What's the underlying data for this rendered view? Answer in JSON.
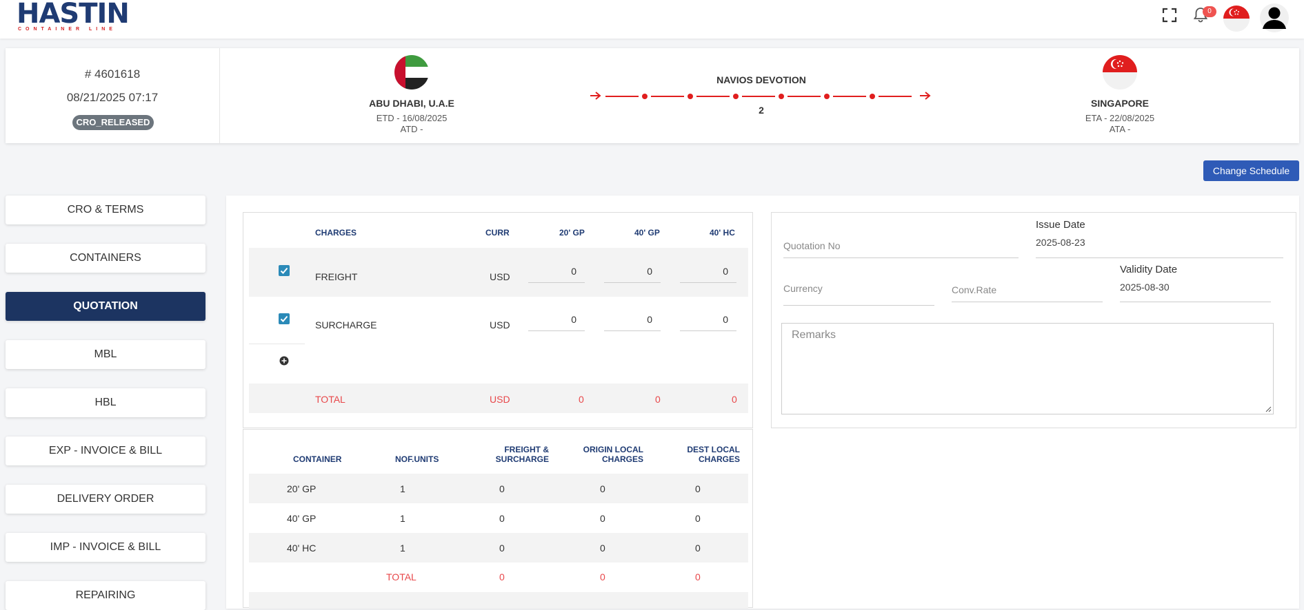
{
  "header": {
    "logo_main": "HASTIN",
    "logo_sub": "CONTAINER LINE",
    "notification_count": "0"
  },
  "voyage": {
    "booking_no": "# 4601618",
    "booking_datetime": "08/21/2025 07:17",
    "status": "CRO_RELEASED",
    "origin": {
      "name": "ABU DHABI, U.A.E",
      "etd": "ETD - 16/08/2025",
      "atd": "ATD -"
    },
    "vessel": "NAVIOS DEVOTION",
    "voyage_no": "2",
    "destination": {
      "name": "SINGAPORE",
      "eta": "ETA - 22/08/2025",
      "ata": "ATA -"
    },
    "change_schedule_label": "Change Schedule"
  },
  "menu": [
    {
      "label": "CRO & TERMS",
      "active": false
    },
    {
      "label": "CONTAINERS",
      "active": false
    },
    {
      "label": "QUOTATION",
      "active": true
    },
    {
      "label": "MBL",
      "active": false
    },
    {
      "label": "HBL",
      "active": false
    },
    {
      "label": "EXP - INVOICE & BILL",
      "active": false
    },
    {
      "label": "DELIVERY ORDER",
      "active": false
    },
    {
      "label": "IMP - INVOICE & BILL",
      "active": false
    },
    {
      "label": "REPAIRING",
      "active": false
    }
  ],
  "charges": {
    "headers": [
      "CHARGES",
      "CURR",
      "20' GP",
      "40' GP",
      "40' HC"
    ],
    "rows": [
      {
        "name": "FREIGHT",
        "curr": "USD",
        "gp20": "0",
        "gp40": "0",
        "hc40": "0",
        "checked": true
      },
      {
        "name": "SURCHARGE",
        "curr": "USD",
        "gp20": "0",
        "gp40": "0",
        "hc40": "0",
        "checked": true
      }
    ],
    "total": {
      "label": "TOTAL",
      "curr": "USD",
      "gp20": "0",
      "gp40": "0",
      "hc40": "0"
    }
  },
  "containers_table": {
    "headers": [
      "CONTAINER",
      "NOF.UNITS",
      "FREIGHT &",
      "SURCHARGE",
      "ORIGIN LOCAL",
      "CHARGES",
      "DEST LOCAL",
      "CHARGES"
    ],
    "rows": [
      {
        "container": "20' GP",
        "units": "1",
        "freight": "0",
        "origin": "0",
        "dest": "0"
      },
      {
        "container": "40' GP",
        "units": "1",
        "freight": "0",
        "origin": "0",
        "dest": "0"
      },
      {
        "container": "40' HC",
        "units": "1",
        "freight": "0",
        "origin": "0",
        "dest": "0"
      }
    ],
    "total": {
      "label": "TOTAL",
      "freight": "0",
      "origin": "0",
      "dest": "0"
    }
  },
  "quotation": {
    "quotation_no_placeholder": "Quotation No",
    "issue_date_label": "Issue Date",
    "issue_date": "2025-08-23",
    "currency_placeholder": "Currency",
    "conv_rate_placeholder": "Conv.Rate",
    "validity_date_label": "Validity Date",
    "validity_date": "2025-08-30",
    "remarks_placeholder": "Remarks"
  },
  "colors": {
    "primary": "#1c3461",
    "accent": "#2f5bb7",
    "route_red": "#e01e1e",
    "total_red": "#e8474a"
  }
}
